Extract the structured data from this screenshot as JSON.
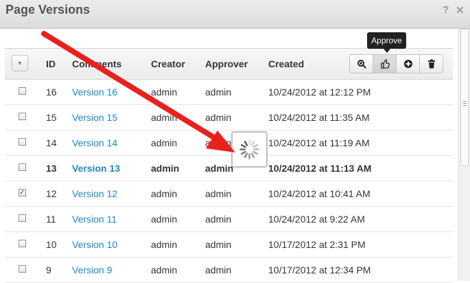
{
  "window": {
    "title": "Page Versions",
    "help_icon": "question-mark-icon",
    "close_icon": "close-icon"
  },
  "toolbar": {
    "select_menu_icon": "dropdown-caret-icon",
    "buttons": [
      {
        "name": "zoom-icon",
        "glyph": "⌕"
      },
      {
        "name": "thumbs-up-icon",
        "glyph": "👍"
      },
      {
        "name": "add-icon",
        "glyph": "⊕"
      },
      {
        "name": "trash-icon",
        "glyph": "🗑"
      }
    ],
    "tooltip": "Approve"
  },
  "columns": {
    "id": "ID",
    "comments": "Comments",
    "creator": "Creator",
    "approver": "Approver",
    "created": "Created"
  },
  "rows": [
    {
      "id": "16",
      "comment": "Version 16",
      "creator": "admin",
      "approver": "admin",
      "created": "10/24/2012 at 12:12 PM",
      "checked": false,
      "bold": false
    },
    {
      "id": "15",
      "comment": "Version 15",
      "creator": "admin",
      "approver": "admin",
      "created": "10/24/2012 at 11:35 AM",
      "checked": false,
      "bold": false
    },
    {
      "id": "14",
      "comment": "Version 14",
      "creator": "admin",
      "approver": "admin",
      "created": "10/24/2012 at 11:19 AM",
      "checked": false,
      "bold": false
    },
    {
      "id": "13",
      "comment": "Version 13",
      "creator": "admin",
      "approver": "admin",
      "created": "10/24/2012 at 11:13 AM",
      "checked": false,
      "bold": true
    },
    {
      "id": "12",
      "comment": "Version 12",
      "creator": "admin",
      "approver": "admin",
      "created": "10/24/2012 at 10:41 AM",
      "checked": true,
      "bold": false
    },
    {
      "id": "11",
      "comment": "Version 11",
      "creator": "admin",
      "approver": "admin",
      "created": "10/24/2012 at 9:22 AM",
      "checked": false,
      "bold": false
    },
    {
      "id": "10",
      "comment": "Version 10",
      "creator": "admin",
      "approver": "admin",
      "created": "10/17/2012 at 2:31 PM",
      "checked": false,
      "bold": false
    },
    {
      "id": "9",
      "comment": "Version 9",
      "creator": "admin",
      "approver": "admin",
      "created": "10/17/2012 at 12:34 PM",
      "checked": false,
      "bold": false
    }
  ],
  "overlay": {
    "arrow_color": "#e8211c",
    "spinner": "loading-spinner-icon"
  }
}
